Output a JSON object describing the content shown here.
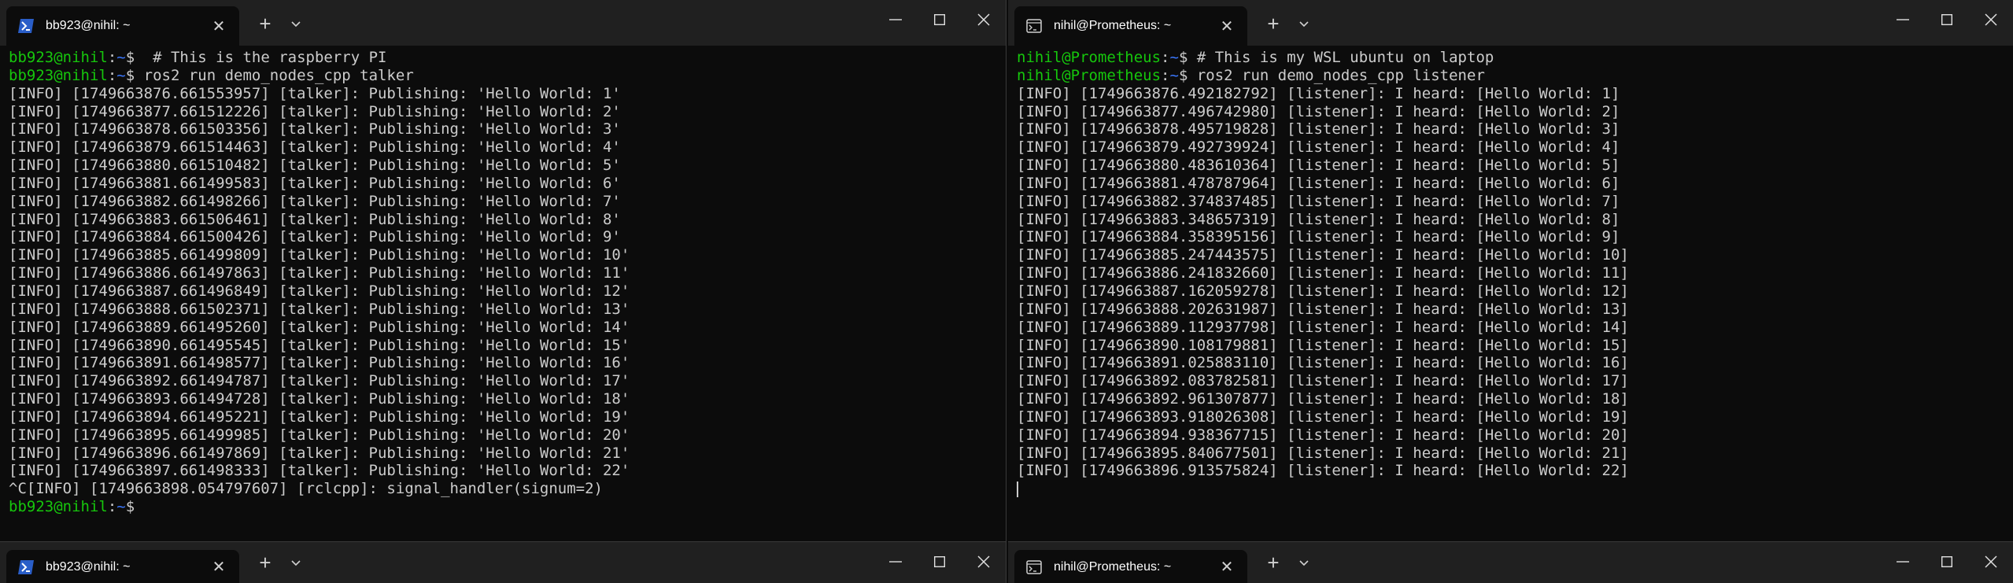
{
  "left": {
    "tab_title": "bb923@nihil: ~",
    "prompt_user": "bb923@nihil",
    "prompt_path": "~",
    "lines": [
      {
        "type": "prompt",
        "cmd": "  # This is the raspberry PI"
      },
      {
        "type": "prompt",
        "cmd": " ros2 run demo_nodes_cpp talker"
      },
      {
        "type": "out",
        "text": "[INFO] [1749663876.661553957] [talker]: Publishing: 'Hello World: 1'"
      },
      {
        "type": "out",
        "text": "[INFO] [1749663877.661512226] [talker]: Publishing: 'Hello World: 2'"
      },
      {
        "type": "out",
        "text": "[INFO] [1749663878.661503356] [talker]: Publishing: 'Hello World: 3'"
      },
      {
        "type": "out",
        "text": "[INFO] [1749663879.661514463] [talker]: Publishing: 'Hello World: 4'"
      },
      {
        "type": "out",
        "text": "[INFO] [1749663880.661510482] [talker]: Publishing: 'Hello World: 5'"
      },
      {
        "type": "out",
        "text": "[INFO] [1749663881.661499583] [talker]: Publishing: 'Hello World: 6'"
      },
      {
        "type": "out",
        "text": "[INFO] [1749663882.661498266] [talker]: Publishing: 'Hello World: 7'"
      },
      {
        "type": "out",
        "text": "[INFO] [1749663883.661506461] [talker]: Publishing: 'Hello World: 8'"
      },
      {
        "type": "out",
        "text": "[INFO] [1749663884.661500426] [talker]: Publishing: 'Hello World: 9'"
      },
      {
        "type": "out",
        "text": "[INFO] [1749663885.661499809] [talker]: Publishing: 'Hello World: 10'"
      },
      {
        "type": "out",
        "text": "[INFO] [1749663886.661497863] [talker]: Publishing: 'Hello World: 11'"
      },
      {
        "type": "out",
        "text": "[INFO] [1749663887.661496849] [talker]: Publishing: 'Hello World: 12'"
      },
      {
        "type": "out",
        "text": "[INFO] [1749663888.661502371] [talker]: Publishing: 'Hello World: 13'"
      },
      {
        "type": "out",
        "text": "[INFO] [1749663889.661495260] [talker]: Publishing: 'Hello World: 14'"
      },
      {
        "type": "out",
        "text": "[INFO] [1749663890.661495545] [talker]: Publishing: 'Hello World: 15'"
      },
      {
        "type": "out",
        "text": "[INFO] [1749663891.661498577] [talker]: Publishing: 'Hello World: 16'"
      },
      {
        "type": "out",
        "text": "[INFO] [1749663892.661494787] [talker]: Publishing: 'Hello World: 17'"
      },
      {
        "type": "out",
        "text": "[INFO] [1749663893.661494728] [talker]: Publishing: 'Hello World: 18'"
      },
      {
        "type": "out",
        "text": "[INFO] [1749663894.661495221] [talker]: Publishing: 'Hello World: 19'"
      },
      {
        "type": "out",
        "text": "[INFO] [1749663895.661499985] [talker]: Publishing: 'Hello World: 20'"
      },
      {
        "type": "out",
        "text": "[INFO] [1749663896.661497869] [talker]: Publishing: 'Hello World: 21'"
      },
      {
        "type": "out",
        "text": "[INFO] [1749663897.661498333] [talker]: Publishing: 'Hello World: 22'"
      },
      {
        "type": "out",
        "text": "^C[INFO] [1749663898.054797607] [rclcpp]: signal_handler(signum=2)"
      },
      {
        "type": "prompt",
        "cmd": ""
      }
    ]
  },
  "right": {
    "tab_title": "nihil@Prometheus: ~",
    "prompt_user": "nihil@Prometheus",
    "prompt_path": "~",
    "lines": [
      {
        "type": "prompt",
        "cmd": " # This is my WSL ubuntu on laptop"
      },
      {
        "type": "prompt",
        "cmd": " ros2 run demo_nodes_cpp listener"
      },
      {
        "type": "out",
        "text": "[INFO] [1749663876.492182792] [listener]: I heard: [Hello World: 1]"
      },
      {
        "type": "out",
        "text": "[INFO] [1749663877.496742980] [listener]: I heard: [Hello World: 2]"
      },
      {
        "type": "out",
        "text": "[INFO] [1749663878.495719828] [listener]: I heard: [Hello World: 3]"
      },
      {
        "type": "out",
        "text": "[INFO] [1749663879.492739924] [listener]: I heard: [Hello World: 4]"
      },
      {
        "type": "out",
        "text": "[INFO] [1749663880.483610364] [listener]: I heard: [Hello World: 5]"
      },
      {
        "type": "out",
        "text": "[INFO] [1749663881.478787964] [listener]: I heard: [Hello World: 6]"
      },
      {
        "type": "out",
        "text": "[INFO] [1749663882.374837485] [listener]: I heard: [Hello World: 7]"
      },
      {
        "type": "out",
        "text": "[INFO] [1749663883.348657319] [listener]: I heard: [Hello World: 8]"
      },
      {
        "type": "out",
        "text": "[INFO] [1749663884.358395156] [listener]: I heard: [Hello World: 9]"
      },
      {
        "type": "out",
        "text": "[INFO] [1749663885.247443575] [listener]: I heard: [Hello World: 10]"
      },
      {
        "type": "out",
        "text": "[INFO] [1749663886.241832660] [listener]: I heard: [Hello World: 11]"
      },
      {
        "type": "out",
        "text": "[INFO] [1749663887.162059278] [listener]: I heard: [Hello World: 12]"
      },
      {
        "type": "out",
        "text": "[INFO] [1749663888.202631987] [listener]: I heard: [Hello World: 13]"
      },
      {
        "type": "out",
        "text": "[INFO] [1749663889.112937798] [listener]: I heard: [Hello World: 14]"
      },
      {
        "type": "out",
        "text": "[INFO] [1749663890.108179881] [listener]: I heard: [Hello World: 15]"
      },
      {
        "type": "out",
        "text": "[INFO] [1749663891.025883110] [listener]: I heard: [Hello World: 16]"
      },
      {
        "type": "out",
        "text": "[INFO] [1749663892.083782581] [listener]: I heard: [Hello World: 17]"
      },
      {
        "type": "out",
        "text": "[INFO] [1749663892.961307877] [listener]: I heard: [Hello World: 18]"
      },
      {
        "type": "out",
        "text": "[INFO] [1749663893.918026308] [listener]: I heard: [Hello World: 19]"
      },
      {
        "type": "out",
        "text": "[INFO] [1749663894.938367715] [listener]: I heard: [Hello World: 20]"
      },
      {
        "type": "out",
        "text": "[INFO] [1749663895.840677501] [listener]: I heard: [Hello World: 21]"
      },
      {
        "type": "out",
        "text": "[INFO] [1749663896.913575824] [listener]: I heard: [Hello World: 22]"
      }
    ]
  },
  "bottom_left": {
    "tab_title": "bb923@nihil: ~"
  },
  "bottom_right": {
    "tab_title": "nihil@Prometheus: ~"
  },
  "glyphs": {
    "close": "✕",
    "new_tab": "+",
    "prompt_symbol": "$",
    "prompt_sep": ":"
  },
  "icons": {
    "left_tab": "powershell-icon",
    "right_tab": "terminal-app-icon"
  },
  "colors": {
    "prompt_user": "#16c60c",
    "prompt_path": "#3b78ff",
    "text": "#cccccc",
    "bg": "#0c0c0c",
    "titlebar": "#202020"
  }
}
